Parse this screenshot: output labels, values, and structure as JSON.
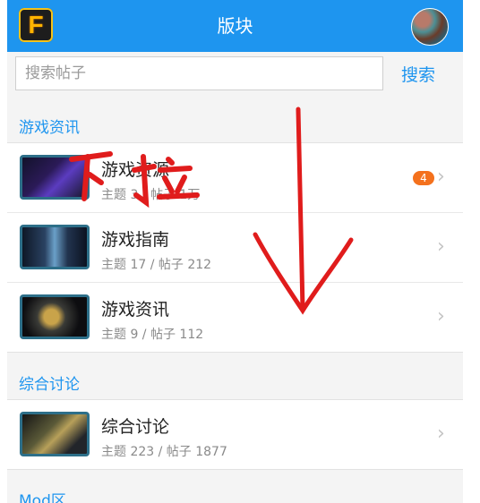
{
  "header": {
    "title": "版块",
    "logo_letter": "F"
  },
  "search": {
    "placeholder": "搜索帖子",
    "value": "",
    "button_label": "搜索"
  },
  "sections": [
    {
      "title": "游戏资讯",
      "forums": [
        {
          "name": "游戏资源",
          "meta": "主题 3 / 帖子 1万",
          "badge": "4"
        },
        {
          "name": "游戏指南",
          "meta": "主题 17 / 帖子 212",
          "badge": ""
        },
        {
          "name": "游戏资讯",
          "meta": "主题 9 / 帖子 112",
          "badge": ""
        }
      ]
    },
    {
      "title": "综合讨论",
      "forums": [
        {
          "name": "综合讨论",
          "meta": "主题 223 / 帖子 1877",
          "badge": ""
        }
      ]
    },
    {
      "title": "Mod区",
      "forums": []
    }
  ],
  "overlay": {
    "handwritten_text": "下拉",
    "stroke_color": "#e01c1c"
  },
  "colors": {
    "accent": "#1e95ef",
    "badge": "#f4711d"
  },
  "icons": {
    "chevron": "chevron-right-icon",
    "down_arrow": "arrow-down-icon"
  }
}
